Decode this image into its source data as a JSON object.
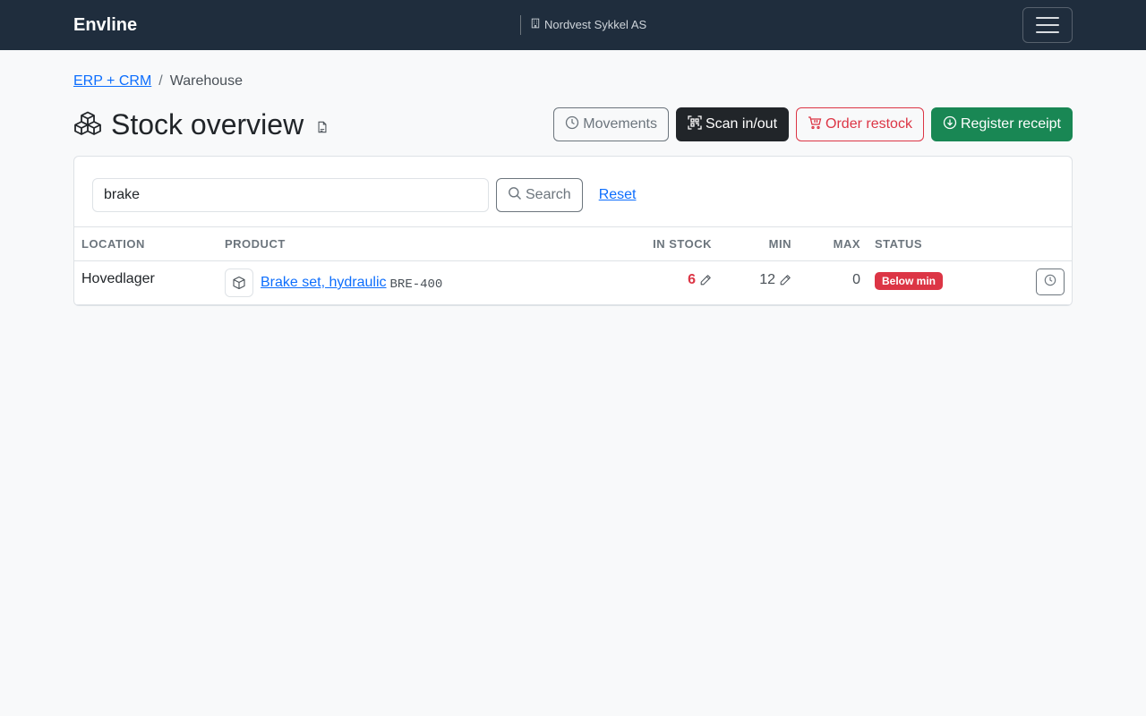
{
  "navbar": {
    "brand": "Envline",
    "organization": "Nordvest Sykkel AS",
    "org_icon": "building-icon",
    "menu_icon": "hamburger-icon"
  },
  "breadcrumb": {
    "parent": "ERP + CRM",
    "separator": "/",
    "current": "Warehouse"
  },
  "page": {
    "title": "Stock overview",
    "title_icon": "boxes-icon",
    "doc_icon": "document-icon"
  },
  "actions": {
    "movements": "Movements",
    "scan": "Scan in/out",
    "order_restock": "Order restock",
    "register_receipt": "Register receipt"
  },
  "search": {
    "value": "brake",
    "button": "Search",
    "reset": "Reset"
  },
  "table": {
    "columns": {
      "location": "Location",
      "product": "Product",
      "in_stock": "In stock",
      "min": "Min",
      "max": "Max",
      "status": "Status"
    },
    "rows": [
      {
        "location": "Hovedlager",
        "product": "Brake set, hydraulic",
        "sku": "BRE-400",
        "in_stock": "6",
        "min": "12",
        "max": "0",
        "status": "Below min"
      }
    ]
  },
  "colors": {
    "navbar": "#1f2d3d",
    "danger": "#dc3545",
    "success": "#198754",
    "link": "#0d6efd"
  }
}
